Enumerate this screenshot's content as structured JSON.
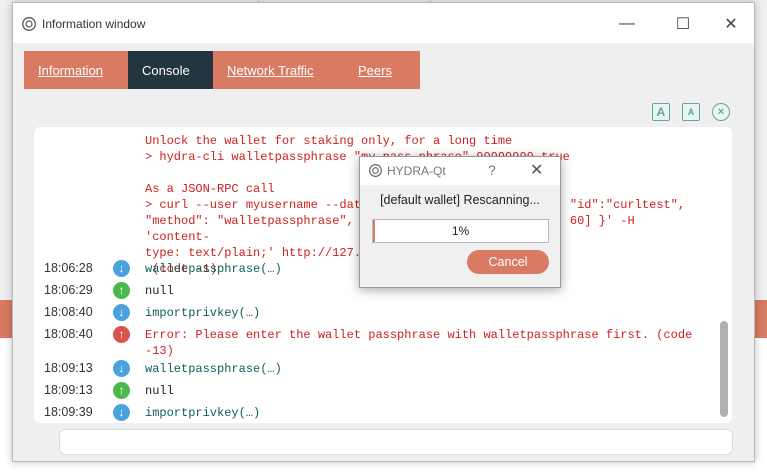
{
  "window": {
    "title": "Information window",
    "minimize": "—",
    "maximize": "☐",
    "close": "✕"
  },
  "tabs": [
    {
      "label": "Information"
    },
    {
      "label": "Console"
    },
    {
      "label": "Network Traffic"
    },
    {
      "label": "Peers"
    }
  ],
  "toolbar": {
    "font_bigger": "A",
    "font_smaller": "A",
    "clear": "×"
  },
  "console": {
    "header_block": "Unlock the wallet for staking only, for a long time\n> hydra-cli walletpassphrase \"my pass phrase\" 99999999 true\n\nAs a JSON-RPC call\n> curl --user myusername --data-binary '{\"jsonrpc\": \"1.0\", \"id\":\"curltest\",\n\"method\": \"walletpassphrase\", \"params\": [\"my pass phrase\", 60] }' -H 'content-\ntype: text/plain;' http://127.0.0.1:3389/\n (code -1)",
    "rows": [
      {
        "time": "18:06:28",
        "kind": "cmd",
        "icon": "↓",
        "text": "walletpassphrase(…)"
      },
      {
        "time": "18:06:29",
        "kind": "ok",
        "icon": "↑",
        "text": "null"
      },
      {
        "time": "18:08:40",
        "kind": "cmd",
        "icon": "↓",
        "text": "importprivkey(…)"
      },
      {
        "time": "18:08:40",
        "kind": "err",
        "icon": "↑",
        "text": "Error: Please enter the wallet passphrase with walletpassphrase first. (code\n-13)"
      },
      {
        "time": "18:09:13",
        "kind": "cmd",
        "icon": "↓",
        "text": "walletpassphrase(…)"
      },
      {
        "time": "18:09:13",
        "kind": "ok",
        "icon": "↑",
        "text": "null"
      },
      {
        "time": "18:09:39",
        "kind": "cmd",
        "icon": "↓",
        "text": "importprivkey(…)"
      }
    ],
    "input_value": ""
  },
  "dialog": {
    "title": "HYDRA-Qt",
    "help": "?",
    "close": "✕",
    "message": "[default wallet] Rescanning...",
    "progress": 0.01,
    "progress_text": "1%",
    "cancel_label": "Cancel"
  },
  "colors": {
    "accent": "#d97a62",
    "tab_active": "#23353f",
    "error": "#d02020",
    "command": "#0d5f5a"
  }
}
